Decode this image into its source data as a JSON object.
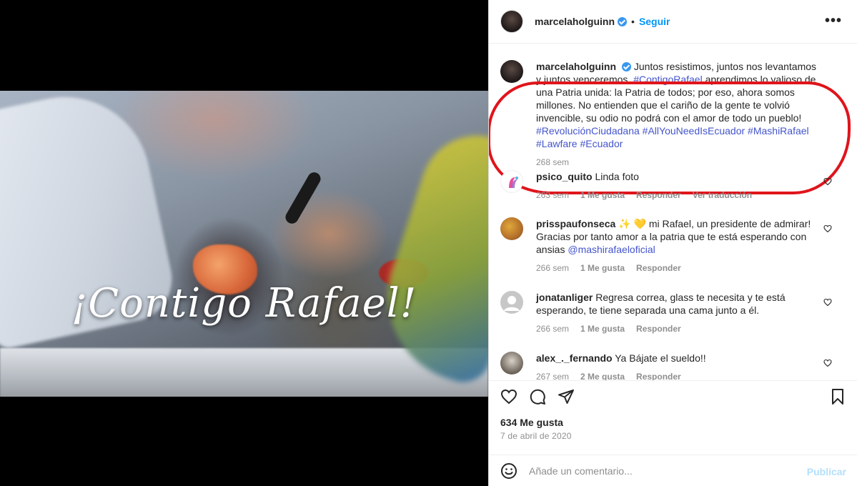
{
  "post": {
    "overlay_text": "¡Contigo Rafael!"
  },
  "header": {
    "username": "marcelaholguinn",
    "dot": "•",
    "follow_label": "Seguir",
    "more_label": "•••"
  },
  "caption": {
    "username": "marcelaholguinn",
    "text1": "Juntos resistimos, juntos nos levantamos y juntos venceremos.",
    "tag1": "#ContigoRafael",
    "text2": "aprendimos lo valioso de una Patria unida: la Patria de todos; por eso, ahora somos millones. No entienden que el cariño de la gente te volvió invencible, su odio no podrá con el amor de todo un pueblo!",
    "tag2": "#RevoluciónCiudadana",
    "tag3": "#AllYouNeedIsEcuador",
    "tag4": "#MashiRafael",
    "tag5": "#Lawfare",
    "tag6": "#Ecuador",
    "time": "268 sem"
  },
  "comments": [
    {
      "username": "psico_quito",
      "text": "Linda foto",
      "time": "263 sem",
      "likes": "1 Me gusta",
      "reply": "Responder",
      "translate": "Ver traducción"
    },
    {
      "username": "prisspaufonseca",
      "emoji": "✨ 💛",
      "text": "mi Rafael, un presidente de admirar! Gracias por tanto amor a la patria que te está esperando con ansias",
      "mention": "@mashirafaeloficial",
      "time": "266 sem",
      "likes": "1 Me gusta",
      "reply": "Responder"
    },
    {
      "username": "jonatanliger",
      "text": "Regresa correa, glass te necesita y te está esperando, te tiene separada una cama junto a él.",
      "time": "266 sem",
      "likes": "1 Me gusta",
      "reply": "Responder"
    },
    {
      "username": "alex_._fernando",
      "text": "Ya Bájate el sueldo!!",
      "time": "267 sem",
      "likes": "2 Me gusta",
      "reply": "Responder"
    }
  ],
  "stats": {
    "likes": "634 Me gusta",
    "date": "7 de abril de 2020"
  },
  "composer": {
    "placeholder": "Añade un comentario...",
    "publish_label": "Publicar"
  },
  "colors": {
    "accent": "#0095f6",
    "hashtag": "#4455cc",
    "annotation": "#e0141b"
  }
}
